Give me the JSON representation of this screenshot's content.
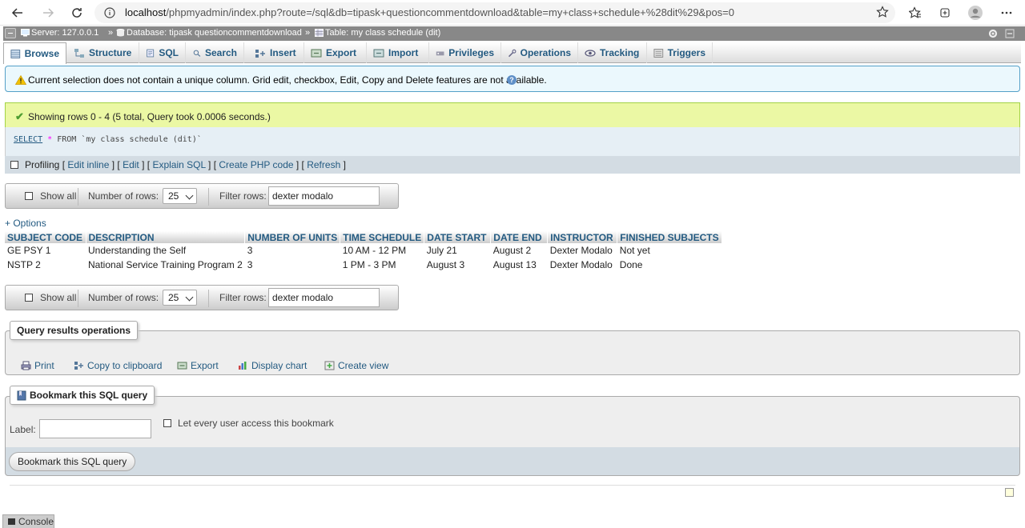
{
  "browser": {
    "url_host": "localhost",
    "url_rest": "/phpmyadmin/index.php?route=/sql&db=tipask+questioncommentdownload&table=my+class+schedule+%28dit%29&pos=0"
  },
  "breadcrumb": {
    "server": "Server: 127.0.0.1",
    "database": "Database: tipask questioncommentdownload",
    "table": "Table: my class schedule (dit)",
    "separator": "»"
  },
  "tabs": [
    {
      "label": "Browse",
      "icon": "browse-icon"
    },
    {
      "label": "Structure",
      "icon": "structure-icon"
    },
    {
      "label": "SQL",
      "icon": "sql-icon"
    },
    {
      "label": "Search",
      "icon": "search-icon"
    },
    {
      "label": "Insert",
      "icon": "insert-icon"
    },
    {
      "label": "Export",
      "icon": "export-icon"
    },
    {
      "label": "Import",
      "icon": "import-icon"
    },
    {
      "label": "Privileges",
      "icon": "privileges-icon"
    },
    {
      "label": "Operations",
      "icon": "operations-icon"
    },
    {
      "label": "Tracking",
      "icon": "tracking-icon"
    },
    {
      "label": "Triggers",
      "icon": "triggers-icon"
    }
  ],
  "notice": {
    "text": "Current selection does not contain a unique column. Grid edit, checkbox, Edit, Copy and Delete features are not available.",
    "help": "?"
  },
  "success": {
    "text": "Showing rows 0 - 4 (5 total, Query took 0.0006 seconds.)"
  },
  "sql": {
    "keyword": "SELECT",
    "star": "*",
    "from": "FROM",
    "table": "`my class schedule (dit)`"
  },
  "query_tools": {
    "profiling": "Profiling",
    "edit_inline": "Edit inline",
    "edit": "Edit",
    "explain": "Explain SQL",
    "create_php": "Create PHP code",
    "refresh": "Refresh"
  },
  "navigation": {
    "show_all": "Show all",
    "rows_label": "Number of rows:",
    "rows_value": "25",
    "filter_label": "Filter rows:",
    "filter_value": "dexter modalo"
  },
  "options_link": "+ Options",
  "table": {
    "columns": [
      "SUBJECT CODE",
      "DESCRIPTION",
      "NUMBER OF UNITS",
      "TIME SCHEDULE",
      "DATE START",
      "DATE END",
      "INSTRUCTOR",
      "FINISHED SUBJECTS"
    ],
    "rows": [
      [
        "GE PSY 1",
        "Understanding the Self",
        "3",
        "10 AM - 12 PM",
        "July 21",
        "August 2",
        "Dexter Modalo",
        "Not yet"
      ],
      [
        "NSTP 2",
        "National Service Training Program 2",
        "3",
        "1 PM - 3 PM",
        "August 3",
        "August 13",
        "Dexter Modalo",
        "Done"
      ]
    ]
  },
  "query_results_ops": {
    "legend": "Query results operations",
    "items": [
      "Print",
      "Copy to clipboard",
      "Export",
      "Display chart",
      "Create view"
    ]
  },
  "bookmark": {
    "legend": "Bookmark this SQL query",
    "label": "Label:",
    "label_value": "",
    "share": "Let every user access this bookmark",
    "button": "Bookmark this SQL query"
  },
  "console": "Console"
}
